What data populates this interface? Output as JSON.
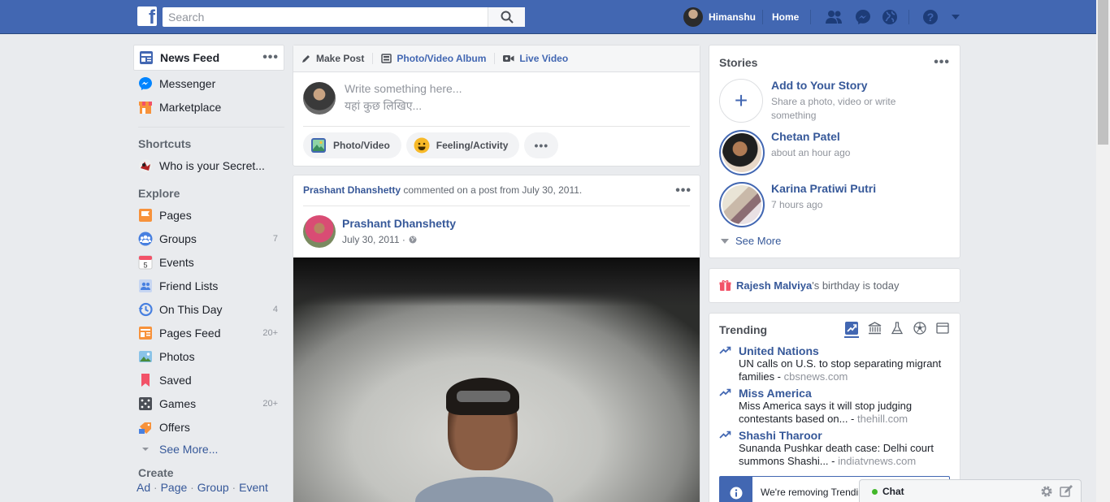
{
  "topbar": {
    "logo_letter": "f",
    "search_placeholder": "Search",
    "user_name": "Himanshu",
    "home_label": "Home"
  },
  "leftnav": {
    "top_items": [
      {
        "label": "News Feed",
        "icon": "news-feed-icon"
      },
      {
        "label": "Messenger",
        "icon": "messenger-icon"
      },
      {
        "label": "Marketplace",
        "icon": "marketplace-icon"
      }
    ],
    "more_dots": "•••",
    "shortcuts_heading": "Shortcuts",
    "shortcut": "Who is your Secret...",
    "explore_heading": "Explore",
    "explore_items": [
      {
        "label": "Pages",
        "count": ""
      },
      {
        "label": "Groups",
        "count": "7"
      },
      {
        "label": "Events",
        "count": ""
      },
      {
        "label": "Friend Lists",
        "count": ""
      },
      {
        "label": "On This Day",
        "count": "4"
      },
      {
        "label": "Pages Feed",
        "count": "20+"
      },
      {
        "label": "Photos",
        "count": ""
      },
      {
        "label": "Saved",
        "count": ""
      },
      {
        "label": "Games",
        "count": "20+"
      },
      {
        "label": "Offers",
        "count": ""
      }
    ],
    "events_day": "5",
    "see_more": "See More...",
    "create_heading": "Create",
    "create_links": [
      "Ad",
      "Page",
      "Group",
      "Event"
    ]
  },
  "composer": {
    "tabs": [
      "Make Post",
      "Photo/Video Album",
      "Live Video"
    ],
    "placeholder_en": "Write something here...",
    "placeholder_hi": "यहां कुछ लिखिए...",
    "actions": [
      "Photo/Video",
      "Feeling/Activity"
    ],
    "more": "•••"
  },
  "post": {
    "header_name": "Prashant Dhanshetty",
    "header_text": " commented on a post from July 30, 2011.",
    "author": "Prashant Dhanshetty",
    "date": "July 30, 2011 ·",
    "dots": "•••"
  },
  "stories": {
    "title": "Stories",
    "dots": "•••",
    "add_title": "Add to Your Story",
    "add_sub": "Share a photo, video or write something",
    "items": [
      {
        "name": "Chetan Patel",
        "time": "about an hour ago"
      },
      {
        "name": "Karina Pratiwi Putri",
        "time": "7 hours ago"
      }
    ],
    "see_more": "See More"
  },
  "birthday": {
    "name": "Rajesh Malviya",
    "text": "'s birthday is today"
  },
  "trending": {
    "title": "Trending",
    "items": [
      {
        "name": "United Nations",
        "text": "UN calls on U.S. to stop separating migrant families - ",
        "source": "cbsnews.com"
      },
      {
        "name": "Miss America",
        "text": "Miss America says it will stop judging contestants based on... - ",
        "source": "thehill.com"
      },
      {
        "name": "Shashi Tharoor",
        "text": "Sunanda Pushkar death case: Delhi court summons Shashi... - ",
        "source": "indiatvnews.com"
      }
    ],
    "notice": "We're removing Trending"
  },
  "chat": {
    "label": "Chat"
  },
  "colors": {
    "brand": "#4267b2",
    "link": "#365899",
    "online": "#42b72a"
  }
}
